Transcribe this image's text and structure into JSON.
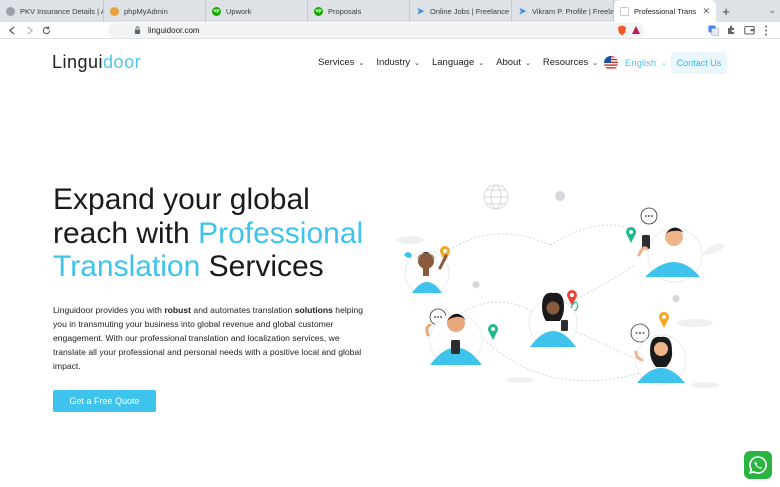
{
  "browser": {
    "tabs": [
      {
        "label": "PKV Insurance Details | Ad",
        "favicon_color": "#9aa0a6"
      },
      {
        "label": "phpMyAdmin",
        "favicon_color": "#e8a23a"
      },
      {
        "label": "Upwork",
        "favicon_color": "#14a800"
      },
      {
        "label": "Proposals",
        "favicon_color": "#14a800"
      },
      {
        "label": "Online Jobs | Freelance Em",
        "favicon_color": "#3a8ee6"
      },
      {
        "label": "Vikram P. Profile | Freelan",
        "favicon_color": "#3a8ee6"
      },
      {
        "label": "Professional Translatio",
        "favicon_color": "#ffffff"
      }
    ],
    "new_tab": "+",
    "url": "linguidoor.com"
  },
  "site": {
    "logo": {
      "part1": "Lingui",
      "part2": "door"
    },
    "nav": [
      {
        "label": "Services"
      },
      {
        "label": "Industry"
      },
      {
        "label": "Language"
      },
      {
        "label": "About"
      },
      {
        "label": "Resources"
      }
    ],
    "language": "English",
    "contact_label": "Contact Us"
  },
  "hero": {
    "title_line1": "Expand your global",
    "title_line2_a": "reach with ",
    "title_line2_b": "Professional",
    "title_line3_a": "Translation",
    "title_line3_b": " Services",
    "body": {
      "p1": "Linguidoor provides you with ",
      "b1": "robust",
      "p2": " and automates translation ",
      "b2": "solutions",
      "p3": " helping you in transmuting your business into global revenue and global customer engagement. With our professional translation and localization services, we translate all your professional and personal needs with a positive local and global impact."
    },
    "cta_label": "Get a Free Quote"
  },
  "colors": {
    "accent": "#3ec3ec",
    "text": "#1a1a1a",
    "whatsapp": "#2ab540"
  },
  "icons": [
    "back-arrow-icon",
    "forward-arrow-icon",
    "reload-icon",
    "bookmark-icon",
    "lock-icon",
    "chevron-down-icon",
    "us-flag-icon",
    "whatsapp-icon",
    "globe-icon",
    "location-pin-icon",
    "chat-bubble-icon"
  ]
}
